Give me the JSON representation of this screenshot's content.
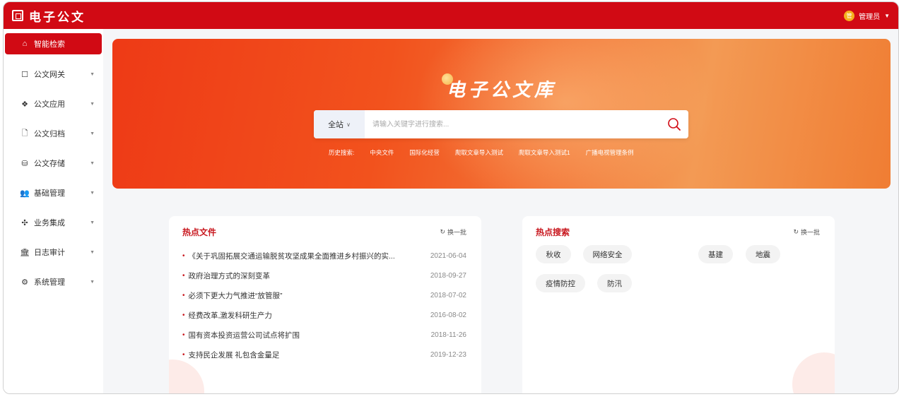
{
  "header": {
    "app_title": "电子公文",
    "user_name": "管理员",
    "user_avatar_text": "管"
  },
  "sidebar": {
    "items": [
      {
        "label": "智能检索",
        "icon": "home-icon",
        "glyph": "⌂",
        "active": true
      },
      {
        "label": "公文网关",
        "icon": "square-icon",
        "glyph": "☐"
      },
      {
        "label": "公文应用",
        "icon": "grid-icon",
        "glyph": "❖"
      },
      {
        "label": "公文归档",
        "icon": "file-icon",
        "glyph": "🗋"
      },
      {
        "label": "公文存储",
        "icon": "storage-icon",
        "glyph": "⛁"
      },
      {
        "label": "基础管理",
        "icon": "users-icon",
        "glyph": "👥"
      },
      {
        "label": "业务集成",
        "icon": "integration-icon",
        "glyph": "✣"
      },
      {
        "label": "日志审计",
        "icon": "bank-icon",
        "glyph": "🏛"
      },
      {
        "label": "系统管理",
        "icon": "gears-icon",
        "glyph": "⚙"
      }
    ]
  },
  "hero": {
    "title": "电子公文库",
    "search": {
      "scope": "全站",
      "placeholder": "请输入关键字进行搜索..."
    },
    "history": {
      "label": "历史搜索:",
      "items": [
        "中央文件",
        "国际化经营",
        "爬取文章导入测试",
        "爬取文章导入测试1",
        "广播电视管理条例"
      ]
    }
  },
  "hot_docs": {
    "title": "热点文件",
    "refresh": "换一批",
    "items": [
      {
        "title": "《关于巩固拓展交通运输脱贫攻坚成果全面推进乡村振兴的实...",
        "date": "2021-06-04"
      },
      {
        "title": "政府治理方式的深刻变革",
        "date": "2018-09-27"
      },
      {
        "title": "必须下更大力气推进“放管服”",
        "date": "2018-07-02"
      },
      {
        "title": "经费改革,激发科研生产力",
        "date": "2016-08-02"
      },
      {
        "title": "国有资本投资运营公司试点将扩围",
        "date": "2018-11-26"
      },
      {
        "title": "支持民企发展 礼包含金量足",
        "date": "2019-12-23"
      }
    ]
  },
  "hot_search": {
    "title": "热点搜索",
    "refresh": "换一批",
    "tags": [
      "秋收",
      "网络安全",
      "",
      "基建",
      "地震",
      "疫情防控",
      "防汛",
      "",
      "",
      ""
    ]
  },
  "colors": {
    "brand_red": "#d10a14",
    "title_red": "#c8171e",
    "hero_orange": "#f2521d"
  }
}
